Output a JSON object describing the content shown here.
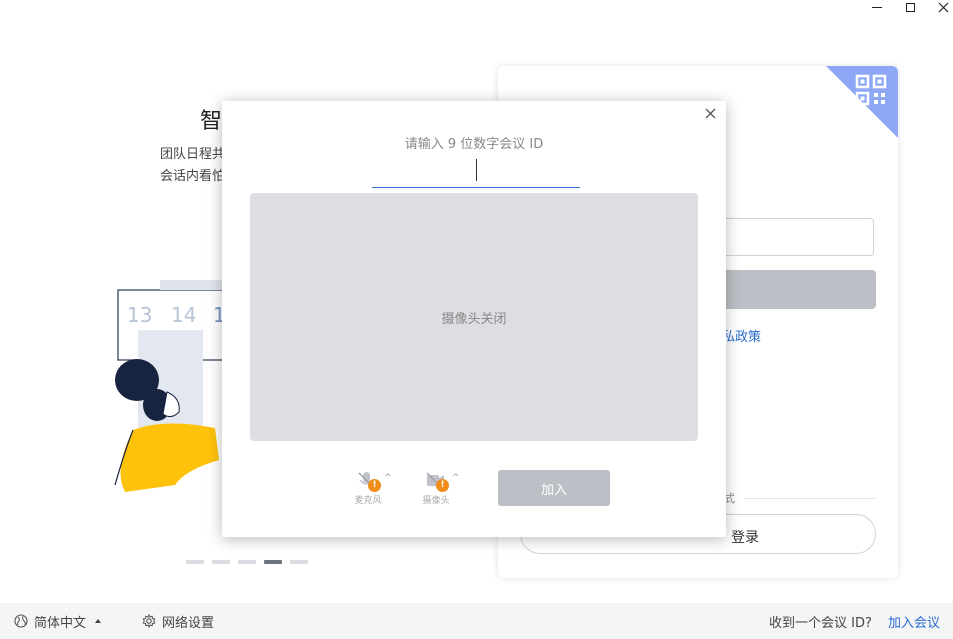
{
  "window": {
    "minimize_icon": "minimize-icon",
    "maximize_icon": "maximize-icon",
    "close_icon": "close-icon"
  },
  "promo": {
    "title": "智",
    "desc_line1": "团队日程共",
    "desc_line2": "会话内看怕",
    "calendar_days": [
      "13",
      "14",
      "1"
    ],
    "dots_total": 5,
    "dots_active_index": 3
  },
  "login_card": {
    "qr_icon": "qr-code-icon",
    "privacy_link": "私政策",
    "other_login_label": "式",
    "wechat_login_label": "登录",
    "wechat_icon": "wechat-icon"
  },
  "bottom_bar": {
    "language_label": "简体中文",
    "network_label": "网络设置",
    "question_label": "收到一个会议 ID?",
    "join_link": "加入会议"
  },
  "dialog": {
    "prompt": "请输入 9 位数字会议 ID",
    "id_value": "",
    "camera_off_text": "摄像头关闭",
    "mic_label": "麦克风",
    "camera_label": "摄像头",
    "join_button": "加入",
    "colors": {
      "accent": "#3a6fd8",
      "warning": "#f08c1a",
      "disabled_button": "#bcc0c6",
      "preview_bg": "#dcdee2"
    }
  }
}
